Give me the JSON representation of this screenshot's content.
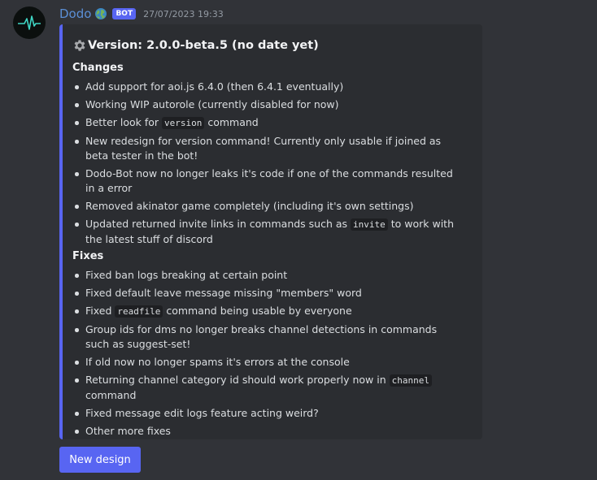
{
  "message": {
    "username": "Dodo",
    "bot_tag": "BOT",
    "timestamp": "27/07/2023 19:33"
  },
  "embed": {
    "accent_color": "#5865f2",
    "title": "Version: 2.0.0-beta.5  (no date yet)",
    "sections": [
      {
        "heading": "Changes",
        "items": [
          {
            "parts": [
              {
                "t": "Add support for aoi.js 6.4.0 (then 6.4.1 eventually)"
              }
            ]
          },
          {
            "parts": [
              {
                "t": "Working WIP autorole (currently disabled for now)"
              }
            ]
          },
          {
            "parts": [
              {
                "t": "Better look for "
              },
              {
                "t": "version",
                "code": true
              },
              {
                "t": " command"
              }
            ]
          },
          {
            "parts": [
              {
                "t": "New redesign for version command! Currently only usable if joined as beta tester in the bot!"
              }
            ]
          },
          {
            "parts": [
              {
                "t": "Dodo-Bot now no longer leaks it's code if one of the commands resulted in a error"
              }
            ]
          },
          {
            "parts": [
              {
                "t": "Removed akinator game completely (including it's own settings)"
              }
            ]
          },
          {
            "parts": [
              {
                "t": "Updated returned invite links in commands such as "
              },
              {
                "t": "invite",
                "code": true
              },
              {
                "t": " to work with the latest stuff of discord"
              }
            ]
          }
        ]
      },
      {
        "heading": "Fixes",
        "items": [
          {
            "parts": [
              {
                "t": "Fixed ban logs breaking at certain point"
              }
            ]
          },
          {
            "parts": [
              {
                "t": "Fixed default leave message missing \"members\" word"
              }
            ]
          },
          {
            "parts": [
              {
                "t": "Fixed "
              },
              {
                "t": "readfile",
                "code": true
              },
              {
                "t": " command being usable by everyone"
              }
            ]
          },
          {
            "parts": [
              {
                "t": "Group ids for dms no longer breaks channel detections in commands such as suggest-set!"
              }
            ]
          },
          {
            "parts": [
              {
                "t": "If old now no longer spams it's errors at the console"
              }
            ]
          },
          {
            "parts": [
              {
                "t": "Returning channel category id should work properly now in "
              },
              {
                "t": "channel",
                "code": true
              },
              {
                "t": " command"
              }
            ]
          },
          {
            "parts": [
              {
                "t": "Fixed message edit logs feature acting weird?"
              }
            ]
          },
          {
            "parts": [
              {
                "t": "Other more fixes"
              }
            ]
          }
        ]
      }
    ]
  },
  "button": {
    "label": "New design"
  },
  "icons": {
    "avatar": "heartbeat-avatar-icon",
    "globe": "globe-icon",
    "gear": "gear-icon"
  }
}
